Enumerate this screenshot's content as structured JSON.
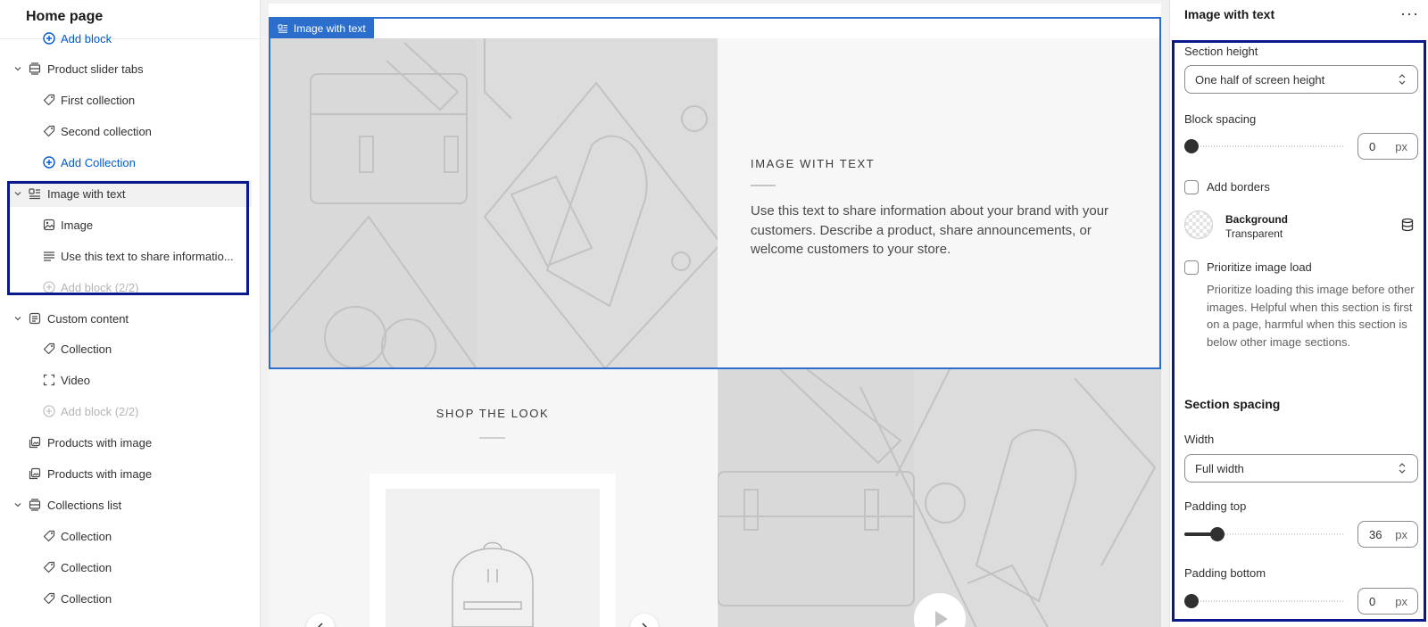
{
  "left_panel": {
    "title": "Home page",
    "items": [
      {
        "label": "Add block",
        "kind": "add"
      },
      {
        "label": "Product slider tabs",
        "kind": "section",
        "icon": "slider-tabs-icon"
      },
      {
        "label": "First collection",
        "kind": "block",
        "icon": "tag-icon"
      },
      {
        "label": "Second collection",
        "kind": "block",
        "icon": "tag-icon"
      },
      {
        "label": "Add Collection",
        "kind": "add"
      },
      {
        "label": "Image with text",
        "kind": "section",
        "icon": "image-with-text-icon",
        "selected": true
      },
      {
        "label": "Image",
        "kind": "block",
        "icon": "image-icon"
      },
      {
        "label": "Use this text to share informatio...",
        "kind": "block",
        "icon": "text-lines-icon"
      },
      {
        "label": "Add block (2/2)",
        "kind": "add-disabled"
      },
      {
        "label": "Custom content",
        "kind": "section",
        "icon": "custom-content-icon"
      },
      {
        "label": "Collection",
        "kind": "block",
        "icon": "tag-icon"
      },
      {
        "label": "Video",
        "kind": "block",
        "icon": "video-frame-icon"
      },
      {
        "label": "Add block (2/2)",
        "kind": "add-disabled"
      },
      {
        "label": "Products with image",
        "kind": "section-noexpand",
        "icon": "products-image-icon"
      },
      {
        "label": "Products with image",
        "kind": "section-noexpand",
        "icon": "products-image-icon"
      },
      {
        "label": "Collections list",
        "kind": "section",
        "icon": "slider-tabs-icon"
      },
      {
        "label": "Collection",
        "kind": "block",
        "icon": "tag-icon"
      },
      {
        "label": "Collection",
        "kind": "block",
        "icon": "tag-icon"
      },
      {
        "label": "Collection",
        "kind": "block",
        "icon": "tag-icon"
      }
    ]
  },
  "preview": {
    "selection_badge": "Image with text",
    "image_with_text": {
      "heading": "IMAGE WITH TEXT",
      "body": "Use this text to share information about your brand with your customers. Describe a product, share announcements, or welcome customers to your store."
    },
    "shop_the_look": {
      "heading": "SHOP THE LOOK"
    }
  },
  "settings": {
    "title": "Image with text",
    "more_label": "···",
    "section_height": {
      "label": "Section height",
      "value": "One half of screen height"
    },
    "block_spacing": {
      "label": "Block spacing",
      "value": "0",
      "unit": "px",
      "level": 0
    },
    "add_borders": {
      "label": "Add borders",
      "checked": false
    },
    "background": {
      "label": "Background",
      "value": "Transparent"
    },
    "prioritize_image_load": {
      "label": "Prioritize image load",
      "checked": false,
      "help": "Prioritize loading this image before other images. Helpful when this section is first on a page, harmful when this section is below other image sections."
    },
    "section_spacing": {
      "heading": "Section spacing"
    },
    "width": {
      "label": "Width",
      "value": "Full width"
    },
    "padding_top": {
      "label": "Padding top",
      "value": "36",
      "unit": "px",
      "level": 0.18
    },
    "padding_bottom": {
      "label": "Padding bottom",
      "value": "0",
      "unit": "px",
      "level": 0
    }
  },
  "colors": {
    "selection_outline": "#0a1a8c",
    "preview_selection": "#2c6ecb",
    "link_blue": "#005bd3"
  }
}
